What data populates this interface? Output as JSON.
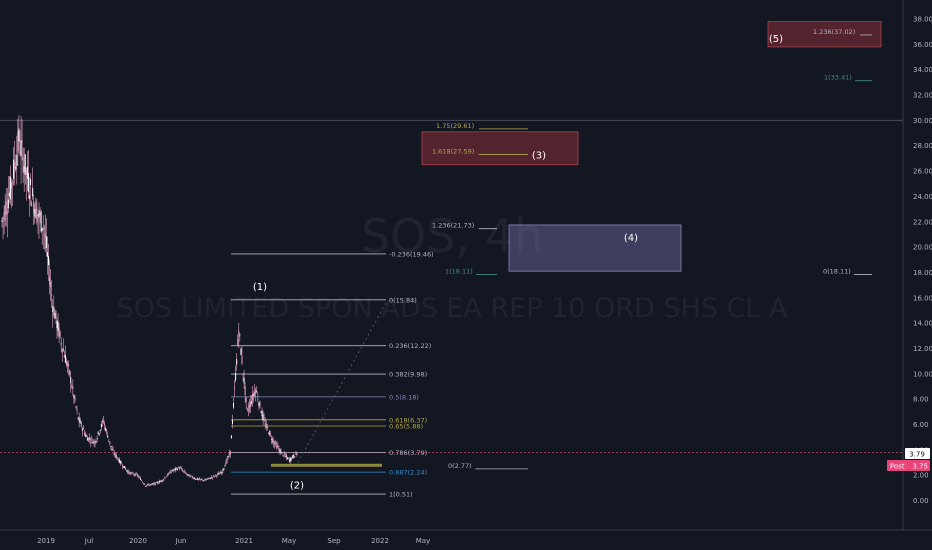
{
  "watermark": {
    "symbol": "SOS, 4h",
    "name": "SOS LIMITED SPON ADS EA REP 10 ORD SHS CL A"
  },
  "colors": {
    "background": "#131722",
    "candle": "#e6a6c4",
    "fib_white": "#b2b5be",
    "fib_gold": "#b5a54e",
    "fib_teal": "#3f8c86",
    "fib_purple": "#8a84b8",
    "fib_blue": "#2f8dd6",
    "last_price_line": "#c7475f",
    "post_badge": "#e8447a"
  },
  "chart_data": {
    "type": "candlestick",
    "symbol": "SOS",
    "interval": "4h",
    "y_axis": {
      "min": 0,
      "max": 38,
      "ticks": [
        "0.00",
        "2.00",
        "4.00",
        "6.00",
        "8.00",
        "10.00",
        "12.00",
        "14.00",
        "16.00",
        "18.00",
        "20.00",
        "22.00",
        "24.00",
        "26.00",
        "28.00",
        "30.00",
        "32.00",
        "34.00",
        "36.00",
        "38.00"
      ],
      "tick_values": [
        0,
        2,
        4,
        6,
        8,
        10,
        12,
        14,
        16,
        18,
        20,
        22,
        24,
        26,
        28,
        30,
        32,
        34,
        36,
        38
      ]
    },
    "x_axis": {
      "ticks": [
        "2019",
        "Jul",
        "2020",
        "Jun",
        "2021",
        "May",
        "Sep",
        "2022",
        "May"
      ]
    },
    "price_series": [
      {
        "t": "2018-11",
        "close": 22.0
      },
      {
        "t": "2018-12",
        "close": 24.5
      },
      {
        "t": "2018-12b",
        "close": 28.5
      },
      {
        "t": "2019-01",
        "close": 25.5
      },
      {
        "t": "2019-02",
        "close": 23.0
      },
      {
        "t": "2019-03",
        "close": 21.5
      },
      {
        "t": "2019-04",
        "close": 15.5
      },
      {
        "t": "2019-05",
        "close": 12.5
      },
      {
        "t": "2019-06",
        "close": 10.0
      },
      {
        "t": "2019-07",
        "close": 6.5
      },
      {
        "t": "2019-08",
        "close": 5.0
      },
      {
        "t": "2019-09",
        "close": 4.6
      },
      {
        "t": "2019-10",
        "close": 6.3
      },
      {
        "t": "2019-11",
        "close": 4.0
      },
      {
        "t": "2019-12",
        "close": 3.0
      },
      {
        "t": "2020-01",
        "close": 2.2
      },
      {
        "t": "2020-02",
        "close": 2.0
      },
      {
        "t": "2020-03",
        "close": 1.2
      },
      {
        "t": "2020-04",
        "close": 1.3
      },
      {
        "t": "2020-05",
        "close": 1.6
      },
      {
        "t": "2020-06",
        "close": 2.3
      },
      {
        "t": "2020-07",
        "close": 2.6
      },
      {
        "t": "2020-08",
        "close": 2.0
      },
      {
        "t": "2020-09",
        "close": 1.7
      },
      {
        "t": "2020-10",
        "close": 1.6
      },
      {
        "t": "2020-11",
        "close": 1.9
      },
      {
        "t": "2020-12",
        "close": 2.2
      },
      {
        "t": "2021-01",
        "close": 3.8
      },
      {
        "t": "2021-02",
        "close": 13.5
      },
      {
        "t": "2021-02b",
        "close": 7.0
      },
      {
        "t": "2021-03",
        "close": 8.8
      },
      {
        "t": "2021-03b",
        "close": 6.2
      },
      {
        "t": "2021-04",
        "close": 4.8
      },
      {
        "t": "2021-04b",
        "close": 3.8
      },
      {
        "t": "2021-05",
        "close": 3.2
      },
      {
        "t": "2021-05b",
        "close": 3.79
      }
    ],
    "last_price": 3.79,
    "post_price": 3.75,
    "fib_retracement_A": {
      "levels": [
        {
          "label": "-0.236(19.46)",
          "ratio": -0.236,
          "price": 19.46,
          "color": "white"
        },
        {
          "label": "0(15.84)",
          "ratio": 0,
          "price": 15.84,
          "color": "white"
        },
        {
          "label": "0.236(12.22)",
          "ratio": 0.236,
          "price": 12.22,
          "color": "white"
        },
        {
          "label": "0.382(9.98)",
          "ratio": 0.382,
          "price": 9.98,
          "color": "white"
        },
        {
          "label": "0.5(8.18)",
          "ratio": 0.5,
          "price": 8.18,
          "color": "purple"
        },
        {
          "label": "0.618(6.37)",
          "ratio": 0.618,
          "price": 6.37,
          "color": "gold"
        },
        {
          "label": "0.65(5.88)",
          "ratio": 0.65,
          "price": 5.88,
          "color": "gold"
        },
        {
          "label": "0.786(3.79)",
          "ratio": 0.786,
          "price": 3.79,
          "color": "white"
        },
        {
          "label": "0.887(2.24)",
          "ratio": 0.887,
          "price": 2.24,
          "color": "blue"
        },
        {
          "label": "1(0.51)",
          "ratio": 1,
          "price": 0.51,
          "color": "white"
        }
      ]
    },
    "fib_extension": {
      "levels": [
        {
          "label": "1.75(29.61)",
          "ratio": 1.75,
          "price": 29.61,
          "color": "gold"
        },
        {
          "label": "1.618(27.59)",
          "ratio": 1.618,
          "price": 27.59,
          "color": "gold"
        },
        {
          "label": "1.236(21.73)",
          "ratio": 1.236,
          "price": 21.73,
          "color": "white"
        },
        {
          "label": "1(18.11)",
          "ratio": 1,
          "price": 18.11,
          "color": "teal"
        },
        {
          "label": "0(2.77)",
          "ratio": 0,
          "price": 2.77,
          "color": "white"
        }
      ]
    },
    "fib_extension_far": {
      "levels": [
        {
          "label": "1.236(37.02)",
          "ratio": 1.236,
          "price": 37.02,
          "color": "white"
        },
        {
          "label": "1(33.41)",
          "ratio": 1,
          "price": 33.41,
          "color": "teal"
        },
        {
          "label": "0(18.11)",
          "ratio": 0,
          "price": 18.11,
          "color": "white"
        }
      ]
    },
    "wave_labels": [
      "(1)",
      "(2)",
      "(3)",
      "(4)",
      "(5)"
    ],
    "horizontal_line_price": 30.0
  },
  "axis_badges": {
    "last": "3.79",
    "post_tag": "Post",
    "post_value": "3.75"
  }
}
